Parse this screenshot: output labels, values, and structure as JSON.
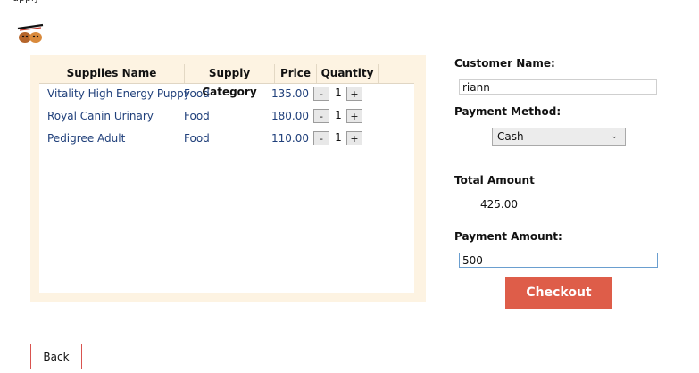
{
  "app": {
    "top_text": "upply"
  },
  "table": {
    "headers": [
      "Supplies Name",
      "Supply Category",
      "Price",
      "Quantity"
    ],
    "rows": [
      {
        "name": "Vitality High Energy Puppy",
        "category": "Food",
        "price": "135.00",
        "qty": "1"
      },
      {
        "name": "Royal Canin Urinary",
        "category": "Food",
        "price": "180.00",
        "qty": "1"
      },
      {
        "name": "Pedigree Adult",
        "category": "Food",
        "price": "110.00",
        "qty": "1"
      }
    ],
    "minus_label": "-",
    "plus_label": "+"
  },
  "form": {
    "customer_name_label": "Customer Name:",
    "customer_name_value": "riann",
    "payment_method_label": "Payment Method:",
    "payment_method_value": "Cash",
    "total_amount_label": "Total Amount",
    "total_amount_value": "425.00",
    "payment_amount_label": "Payment Amount:",
    "payment_amount_value": "500"
  },
  "buttons": {
    "checkout": "Checkout",
    "back": "Back"
  },
  "icons": {
    "logo": "pets-r-us-logo-icon",
    "dropdown": "chevron-down-icon"
  },
  "colors": {
    "checkout_bg": "#de5d49",
    "panel_bg": "#fdf3e2",
    "link_text": "#1f3f7a",
    "back_border": "#d9534f"
  }
}
